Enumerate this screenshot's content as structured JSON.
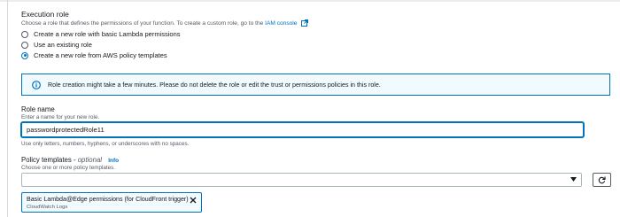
{
  "execution_role": {
    "title": "Execution role",
    "description": "Choose a role that defines the permissions of your function. To create a custom role, go to the",
    "link": "IAM console",
    "options": [
      {
        "label": "Create a new role with basic Lambda permissions",
        "selected": false
      },
      {
        "label": "Use an existing role",
        "selected": false
      },
      {
        "label": "Create a new role from AWS policy templates",
        "selected": true
      }
    ]
  },
  "alert": {
    "icon": "info-icon",
    "message": "Role creation might take a few minutes. Please do not delete the role or edit the trust or permissions policies in this role."
  },
  "role_name": {
    "label": "Role name",
    "hint": "Enter a name for your new role.",
    "value": "passwordprotectedRole11",
    "constraint": "Use only letters, numbers, hyphens, or underscores with no spaces."
  },
  "policy_templates": {
    "label": "Policy templates",
    "optional": "optional",
    "info": "Info",
    "hint": "Choose one or more policy templates.",
    "selected_tokens": [
      {
        "title": "Basic Lambda@Edge permissions (for CloudFront trigger)",
        "subtitle": "CloudWatch Logs"
      }
    ]
  },
  "colors": {
    "accent": "#0073bb",
    "alert_background": "#f1faff",
    "text": "#16191f",
    "muted": "#545b64"
  }
}
